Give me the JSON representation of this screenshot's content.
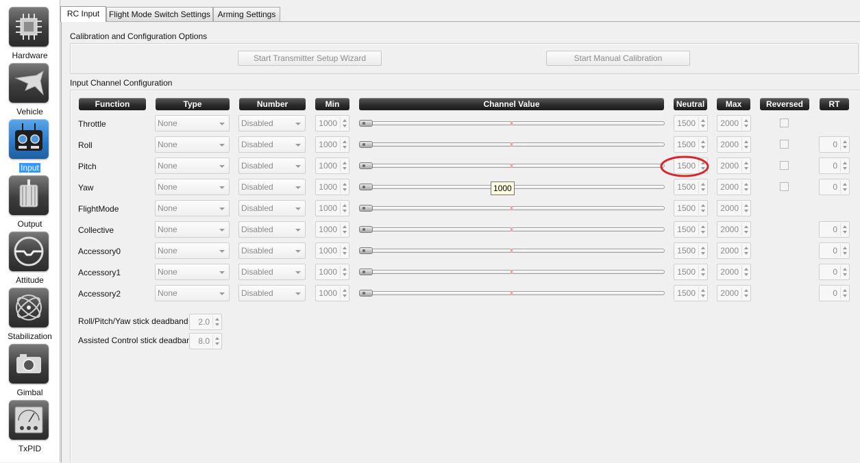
{
  "sidebar": {
    "items": [
      {
        "label": "Hardware",
        "icon": "chip-icon"
      },
      {
        "label": "Vehicle",
        "icon": "airframe-icon"
      },
      {
        "label": "Input",
        "icon": "transmitter-icon",
        "active": true
      },
      {
        "label": "Output",
        "icon": "motor-icon"
      },
      {
        "label": "Attitude",
        "icon": "attitude-icon"
      },
      {
        "label": "Stabilization",
        "icon": "gyro-icon"
      },
      {
        "label": "Gimbal",
        "icon": "camera-icon"
      },
      {
        "label": "TxPID",
        "icon": "meter-icon"
      }
    ]
  },
  "tabs": [
    {
      "label": "RC Input",
      "active": true
    },
    {
      "label": "Flight Mode Switch Settings"
    },
    {
      "label": "Arming Settings"
    }
  ],
  "calibration": {
    "title": "Calibration and Configuration Options",
    "wizard_button": "Start Transmitter Setup Wizard",
    "manual_button": "Start Manual Calibration"
  },
  "channels": {
    "title": "Input Channel Configuration",
    "headers": {
      "function": "Function",
      "type": "Type",
      "number": "Number",
      "min": "Min",
      "channel_value": "Channel Value",
      "neutral": "Neutral",
      "max": "Max",
      "reversed": "Reversed",
      "rt": "RT"
    },
    "rows": [
      {
        "function": "Throttle",
        "type": "None",
        "number": "Disabled",
        "min": "1000",
        "neutral": "1500",
        "max": "2000"
      },
      {
        "function": "Roll",
        "type": "None",
        "number": "Disabled",
        "min": "1000",
        "neutral": "1500",
        "max": "2000",
        "rt": "0"
      },
      {
        "function": "Pitch",
        "type": "None",
        "number": "Disabled",
        "min": "1000",
        "neutral": "1500",
        "max": "2000",
        "rt": "0"
      },
      {
        "function": "Yaw",
        "type": "None",
        "number": "Disabled",
        "min": "1000",
        "neutral": "1500",
        "max": "2000",
        "rt": "0"
      },
      {
        "function": "FlightMode",
        "type": "None",
        "number": "Disabled",
        "min": "1000",
        "neutral": "1500",
        "max": "2000"
      },
      {
        "function": "Collective",
        "type": "None",
        "number": "Disabled",
        "min": "1000",
        "neutral": "1500",
        "max": "2000",
        "rt": "0"
      },
      {
        "function": "Accessory0",
        "type": "None",
        "number": "Disabled",
        "min": "1000",
        "neutral": "1500",
        "max": "2000",
        "rt": "0"
      },
      {
        "function": "Accessory1",
        "type": "None",
        "number": "Disabled",
        "min": "1000",
        "neutral": "1500",
        "max": "2000",
        "rt": "0"
      },
      {
        "function": "Accessory2",
        "type": "None",
        "number": "Disabled",
        "min": "1000",
        "neutral": "1500",
        "max": "2000",
        "rt": "0"
      }
    ],
    "tooltip": "1000"
  },
  "deadbands": {
    "rpy_label": "Roll/Pitch/Yaw stick deadband",
    "rpy_value": "2.0",
    "assisted_label": "Assisted Control stick deadband",
    "assisted_value": "8.0"
  },
  "colors": {
    "active_sidebar_highlight": "#3399ff",
    "annotation_ellipse": "#d9262b",
    "slider_neutral_mark": "#f3a3a3"
  }
}
